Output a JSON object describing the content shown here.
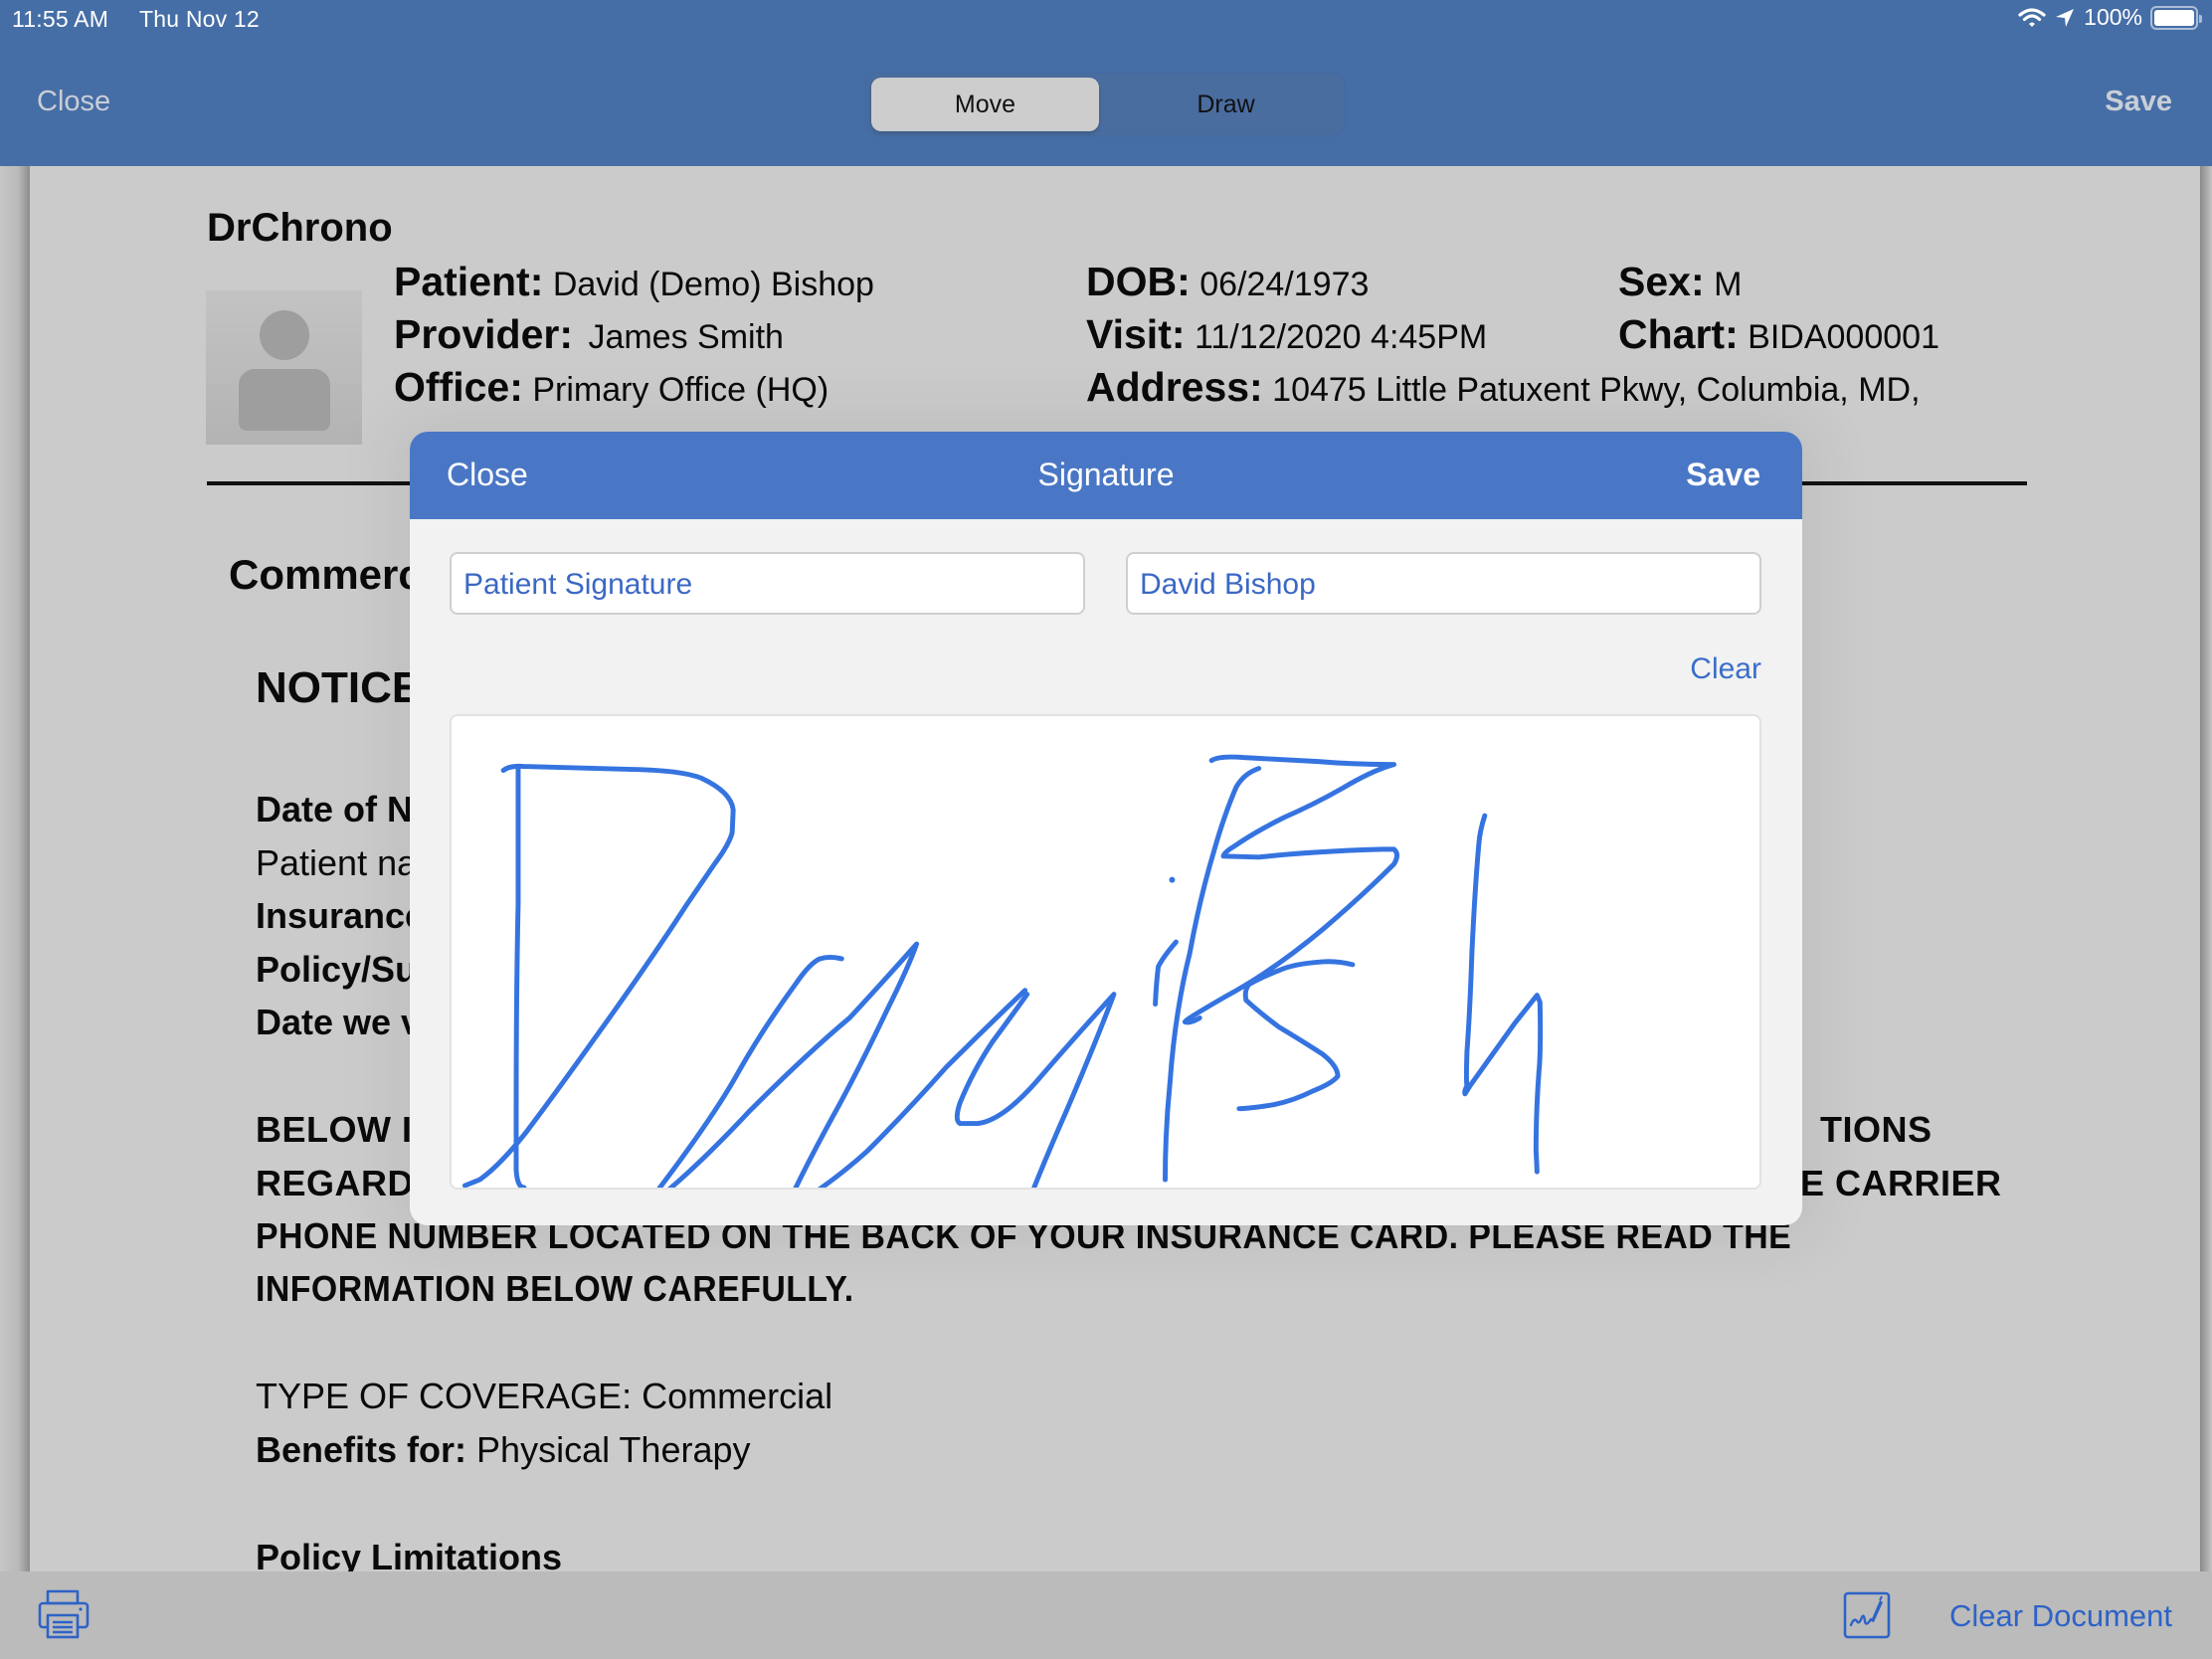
{
  "status_bar": {
    "time": "11:55 AM",
    "date": "Thu Nov 12",
    "battery": "100%",
    "icons": [
      "wifi-icon",
      "location-arrow-icon",
      "battery-icon"
    ]
  },
  "top_bar": {
    "close_label": "Close",
    "save_label": "Save",
    "modes": [
      {
        "label": "Move",
        "selected": true
      },
      {
        "label": "Draw",
        "selected": false
      }
    ]
  },
  "document": {
    "brand": "DrChrono",
    "patient_label": "Patient:",
    "patient": "David (Demo) Bishop",
    "provider_label": "Provider:",
    "provider": "James Smith",
    "office_label": "Office:",
    "office": "Primary Office (HQ)",
    "dob_label": "DOB:",
    "dob": "06/24/1973",
    "visit_label": "Visit:",
    "visit": "11/12/2020 4:45PM",
    "address_label": "Address:",
    "address": "10475 Little Patuxent Pkwy, Columbia, MD,",
    "sex_label": "Sex:",
    "sex": "M",
    "chart_label": "Chart:",
    "chart": "BIDA000001",
    "section_title": "Commerc",
    "notice_title": "NOTICE",
    "lines": [
      {
        "text": "Date of N",
        "bold": true
      },
      {
        "text": "Patient na",
        "bold": false
      },
      {
        "text": "Insurance",
        "bold": true
      },
      {
        "text": "Policy/Su",
        "bold": true
      },
      {
        "text": "Date we v",
        "bold": true
      }
    ],
    "caps_line1_start": "BELOW I",
    "caps_line1_end": "TIONS",
    "caps_line2_start": "REGARD",
    "caps_line2_end": "E CARRIER",
    "caps_line3": "PHONE NUMBER LOCATED ON THE BACK OF YOUR INSURANCE CARD. PLEASE READ THE",
    "caps_line4": "INFORMATION BELOW CAREFULLY.",
    "coverage_label": "TYPE OF COVERAGE:",
    "coverage": "Commercial",
    "benefits_label": "Benefits for:",
    "benefits": "Physical Therapy",
    "policy_limitations": "Policy Limitations"
  },
  "signature_modal": {
    "close_label": "Close",
    "title": "Signature",
    "save_label": "Save",
    "signature_type": "Patient Signature",
    "signer_name": "David Bishop",
    "clear_label": "Clear",
    "ink_color": "#3574e0",
    "signature_drawn": true
  },
  "bottom_bar": {
    "print_icon": "printer-icon",
    "sign_icon": "signature-pen-icon",
    "clear_document_label": "Clear Document"
  },
  "colors": {
    "header_bg": "#466ea6",
    "modal_header_bg": "#4a77c5",
    "link_blue": "#2d63c7"
  }
}
